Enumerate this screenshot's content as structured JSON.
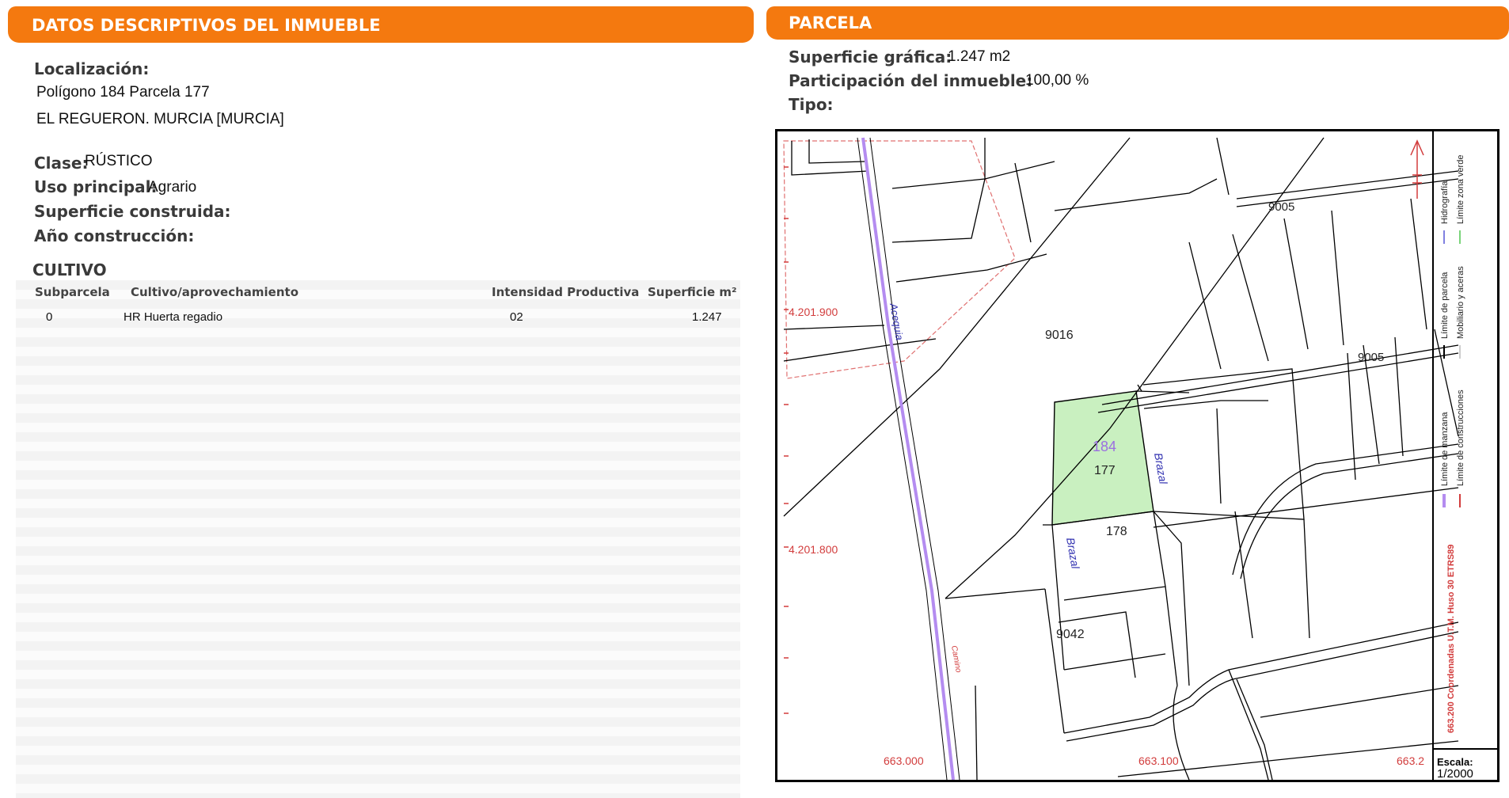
{
  "left": {
    "header": "DATOS DESCRIPTIVOS DEL INMUEBLE",
    "localizacion_label": "Localización:",
    "localizacion_line1": "Polígono 184 Parcela 177",
    "localizacion_line2": "EL REGUERON. MURCIA [MURCIA]",
    "clase_label": "Clase:",
    "clase_value": "RÚSTICO",
    "uso_label": "Uso principal:",
    "uso_value": "Agrario",
    "superficie_label": "Superficie construida:",
    "anio_label": "Año construcción:",
    "cultivo_title": "CULTIVO",
    "table": {
      "headers": [
        "Subparcela",
        "Cultivo/aprovechamiento",
        "Intensidad Productiva",
        "Superficie m²"
      ],
      "rows": [
        {
          "subparcela": "0",
          "cultivo": "HR Huerta regadio",
          "intensidad": "02",
          "superficie": "1.247"
        }
      ]
    }
  },
  "right": {
    "header": "PARCELA",
    "superficie_label": "Superficie gráfica:",
    "superficie_value": "1.247 m2",
    "participacion_label": "Participación del inmueble:",
    "participacion_value": "100,00 %",
    "tipo_label": "Tipo:",
    "map": {
      "parcel_polygon": "184",
      "parcel_number": "177",
      "labels": [
        "9005",
        "9016",
        "9005",
        "178",
        "9042"
      ],
      "road_labels": [
        "Brazal",
        "Brazal",
        "Acequia",
        "Camino"
      ],
      "y_coords": [
        "4.201.900",
        "4.201.800"
      ],
      "x_coords": [
        "663.000",
        "663.100",
        "663.2"
      ],
      "legend": {
        "manzana": "Límite de manzana",
        "parcela": "Límite de parcela",
        "hidrografia": "Hidrografía",
        "construcciones": "Límite de construcciones",
        "mobiliario": "Mobiliario y aceras",
        "zona_verde": "Límite zona verde",
        "coords": "663.200 Coordenadas U.T.M. Huso 30 ETRS89"
      },
      "scale_label": "Escala:",
      "scale_value": "1/2000",
      "colors": {
        "parcel_fill": "#c9f0c0",
        "hydro": "#b48cf0",
        "limit_red": "#d23c3c",
        "header": "#f4790f"
      }
    }
  }
}
